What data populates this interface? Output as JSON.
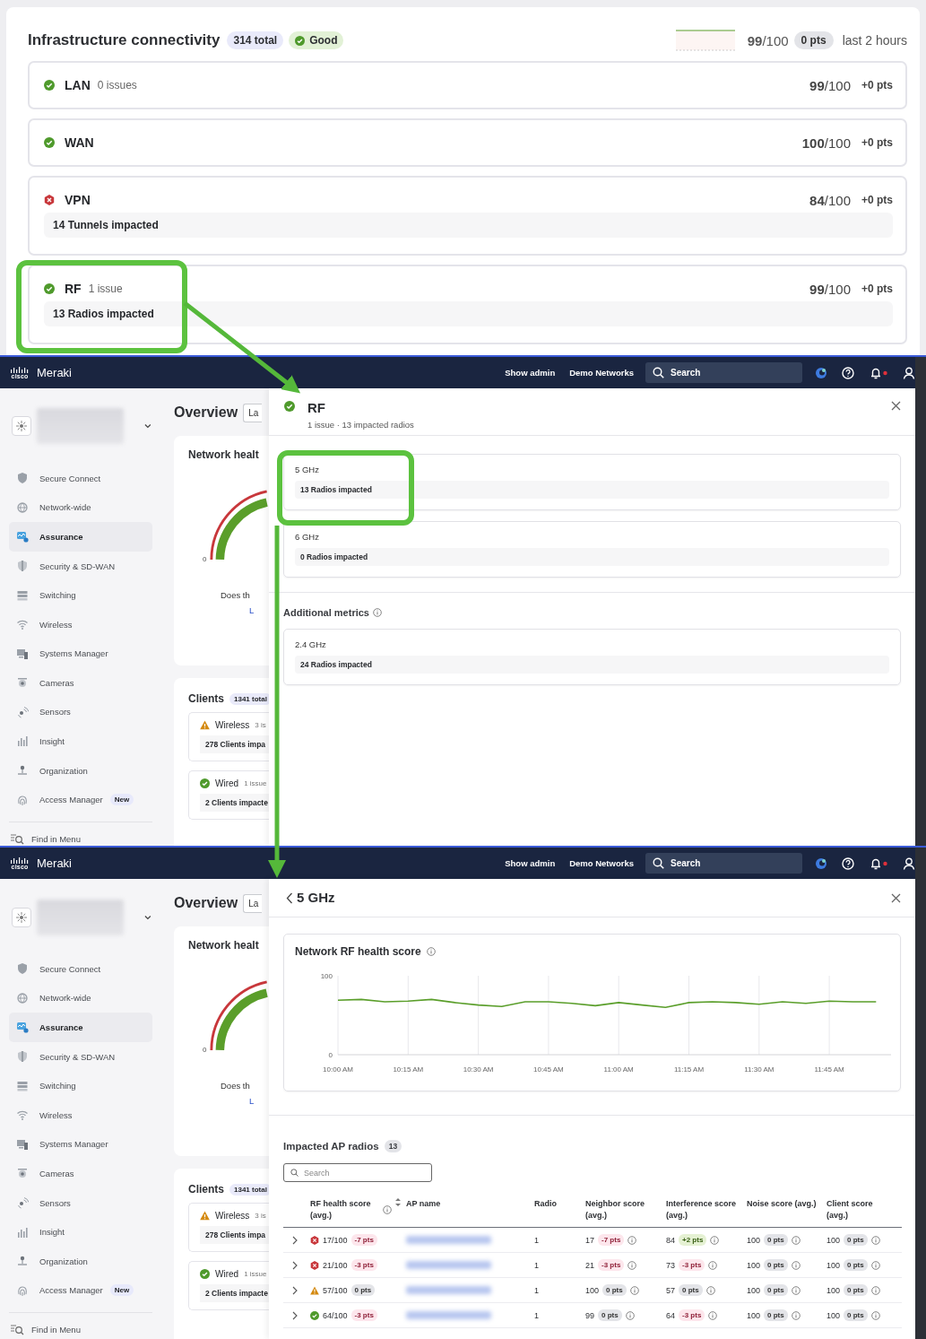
{
  "connectivity": {
    "title": "Infrastructure connectivity",
    "total": "314 total",
    "status": {
      "kind": "good",
      "label": "Good"
    },
    "score": "**99**/100",
    "delta": "0 pts",
    "period": "last 2 hours",
    "rows": [
      {
        "name": "LAN",
        "status": {
          "kind": "good"
        },
        "issues": "0 issues",
        "score": "**99**/100",
        "delta": "+0 pts"
      },
      {
        "name": "WAN",
        "status": {
          "kind": "good"
        },
        "score": "**100**/100",
        "delta": "+0 pts"
      },
      {
        "name": "VPN",
        "status": {
          "kind": "error"
        },
        "score": "**84**/100",
        "delta": "+0 pts",
        "impact": "**14** Tunnels impacted"
      },
      {
        "name": "RF",
        "status": {
          "kind": "good"
        },
        "issues": "1 issue",
        "score": "**99**/100",
        "delta": "+0 pts",
        "impact": "**13** Radios impacted"
      }
    ]
  },
  "screens": [
    {
      "topbar": {
        "brand_mark": "cisco",
        "brand": "Meraki",
        "links": [
          "Show admin",
          "Demo Networks"
        ],
        "search": {
          "placeholder": "Search"
        },
        "notification_dot": true
      },
      "sidebar": {
        "items": [
          {
            "label": "Secure Connect",
            "selected": false
          },
          {
            "label": "Network-wide",
            "selected": false
          },
          {
            "label": "Assurance",
            "selected": true
          },
          {
            "label": "Security & SD-WAN",
            "selected": false
          },
          {
            "label": "Switching",
            "selected": false
          },
          {
            "label": "Wireless",
            "selected": false
          },
          {
            "label": "Systems Manager",
            "selected": false
          },
          {
            "label": "Cameras",
            "selected": false
          },
          {
            "label": "Sensors",
            "selected": false
          },
          {
            "label": "Insight",
            "selected": false
          },
          {
            "label": "Organization",
            "selected": false
          },
          {
            "label": "Access Manager",
            "selected": false,
            "badge": "New"
          }
        ],
        "find": "Find in Menu"
      },
      "overview": {
        "title": "Overview",
        "filter": "La",
        "health": {
          "title": "Network healt",
          "gauge_min": "0",
          "question": "Does th",
          "link": "L"
        },
        "clients": {
          "title": "Clients",
          "total": "1341 total",
          "groups": [
            {
              "status": {
                "kind": "warning"
              },
              "name": "Wireless",
              "issues": "3 is",
              "impact": "**278** Clients impa"
            },
            {
              "status": {
                "kind": "good"
              },
              "name": "Wired",
              "issues": "1 issue",
              "impact": "**2** Clients impacte"
            }
          ]
        }
      },
      "drawer": {
        "kind": "summary",
        "status": {
          "kind": "good"
        },
        "title": "RF",
        "subtitle": "1 issue · 13 impacted radios",
        "bands": [
          {
            "name": "5 GHz",
            "impact": "**13** Radios impacted"
          },
          {
            "name": "6 GHz",
            "impact": "**0** Radios impacted"
          }
        ],
        "additional": {
          "title": "Additional metrics",
          "bands": [
            {
              "name": "2.4 GHz",
              "impact": "**24** Radios impacted"
            }
          ]
        }
      }
    },
    {
      "topbar": {
        "brand_mark": "cisco",
        "brand": "Meraki",
        "links": [
          "Show admin",
          "Demo Networks"
        ],
        "search": {
          "placeholder": "Search"
        },
        "notification_dot": true
      },
      "sidebar": {
        "items": [
          {
            "label": "Secure Connect",
            "selected": false
          },
          {
            "label": "Network-wide",
            "selected": false
          },
          {
            "label": "Assurance",
            "selected": true
          },
          {
            "label": "Security & SD-WAN",
            "selected": false
          },
          {
            "label": "Switching",
            "selected": false
          },
          {
            "label": "Wireless",
            "selected": false
          },
          {
            "label": "Systems Manager",
            "selected": false
          },
          {
            "label": "Cameras",
            "selected": false
          },
          {
            "label": "Sensors",
            "selected": false
          },
          {
            "label": "Insight",
            "selected": false
          },
          {
            "label": "Organization",
            "selected": false
          },
          {
            "label": "Access Manager",
            "selected": false,
            "badge": "New"
          }
        ],
        "find": "Find in Menu"
      },
      "overview": {
        "title": "Overview",
        "filter": "La",
        "health": {
          "title": "Network healt",
          "gauge_min": "0",
          "question": "Does th",
          "link": "L"
        },
        "clients": {
          "title": "Clients",
          "total": "1341 total",
          "groups": [
            {
              "status": {
                "kind": "warning"
              },
              "name": "Wireless",
              "issues": "3 is",
              "impact": "**278** Clients impa"
            },
            {
              "status": {
                "kind": "good"
              },
              "name": "Wired",
              "issues": "1 issue",
              "impact": "**2** Clients impacte"
            }
          ]
        }
      },
      "drawer": {
        "kind": "detail",
        "title": "5 GHz",
        "chart": {
          "title": "Network RF health score",
          "chart_data": {
            "type": "line",
            "categories": [
              "10:00 AM",
              null,
              null,
              "10:15 AM",
              null,
              null,
              "10:30 AM",
              null,
              null,
              "10:45 AM",
              null,
              null,
              "11:00 AM",
              null,
              null,
              "11:15 AM",
              null,
              null,
              "11:30 AM",
              null,
              null,
              "11:45 AM",
              null,
              null
            ],
            "series": [
              {
                "color": "#5a9e2a",
                "values": [
                  69,
                  70,
                  67,
                  68,
                  70,
                  66,
                  63,
                  61,
                  67,
                  67,
                  65,
                  62,
                  66,
                  63,
                  60,
                  66,
                  67,
                  66,
                  64,
                  67,
                  65,
                  68,
                  67,
                  67
                ]
              }
            ],
            "ylim": [
              0,
              100
            ],
            "yticks": [
              0,
              100
            ],
            "grid": true
          }
        },
        "radios": {
          "title": "Impacted AP radios",
          "count": "13",
          "search": {
            "placeholder": "Search"
          },
          "columns": [
            "RF health score (avg.)",
            "AP name",
            "Radio",
            "Neighbor score (avg.)",
            "Interference score (avg.)",
            "Noise score (avg.)",
            "Client score (avg.)"
          ],
          "rows": [
            {
              "status": {
                "kind": "error"
              },
              "score": "17/100",
              "delta": {
                "label": "-7 pts",
                "kind": "negative"
              },
              "radio": "1",
              "metrics": [
                {
                  "value": "17",
                  "delta": {
                    "label": "-7 pts",
                    "kind": "negative"
                  }
                },
                {
                  "value": "84",
                  "delta": {
                    "label": "+2 pts",
                    "kind": "positive"
                  }
                },
                {
                  "value": "100",
                  "delta": {
                    "label": "0 pts",
                    "kind": "neutral"
                  }
                },
                {
                  "value": "100",
                  "delta": {
                    "label": "0 pts",
                    "kind": "neutral"
                  }
                }
              ]
            },
            {
              "status": {
                "kind": "error"
              },
              "score": "21/100",
              "delta": {
                "label": "-3 pts",
                "kind": "negative"
              },
              "radio": "1",
              "metrics": [
                {
                  "value": "21",
                  "delta": {
                    "label": "-3 pts",
                    "kind": "negative"
                  }
                },
                {
                  "value": "73",
                  "delta": {
                    "label": "-3 pts",
                    "kind": "negative"
                  }
                },
                {
                  "value": "100",
                  "delta": {
                    "label": "0 pts",
                    "kind": "neutral"
                  }
                },
                {
                  "value": "100",
                  "delta": {
                    "label": "0 pts",
                    "kind": "neutral"
                  }
                }
              ]
            },
            {
              "status": {
                "kind": "warning"
              },
              "score": "57/100",
              "delta": {
                "label": "0 pts",
                "kind": "neutral"
              },
              "radio": "1",
              "metrics": [
                {
                  "value": "100",
                  "delta": {
                    "label": "0 pts",
                    "kind": "neutral"
                  }
                },
                {
                  "value": "57",
                  "delta": {
                    "label": "0 pts",
                    "kind": "neutral"
                  }
                },
                {
                  "value": "100",
                  "delta": {
                    "label": "0 pts",
                    "kind": "neutral"
                  }
                },
                {
                  "value": "100",
                  "delta": {
                    "label": "0 pts",
                    "kind": "neutral"
                  }
                }
              ]
            },
            {
              "status": {
                "kind": "good"
              },
              "score": "64/100",
              "delta": {
                "label": "-3 pts",
                "kind": "negative"
              },
              "radio": "1",
              "metrics": [
                {
                  "value": "99",
                  "delta": {
                    "label": "0 pts",
                    "kind": "neutral"
                  }
                },
                {
                  "value": "64",
                  "delta": {
                    "label": "-3 pts",
                    "kind": "negative"
                  }
                },
                {
                  "value": "100",
                  "delta": {
                    "label": "0 pts",
                    "kind": "neutral"
                  }
                },
                {
                  "value": "100",
                  "delta": {
                    "label": "0 pts",
                    "kind": "neutral"
                  }
                }
              ]
            }
          ]
        }
      }
    }
  ]
}
